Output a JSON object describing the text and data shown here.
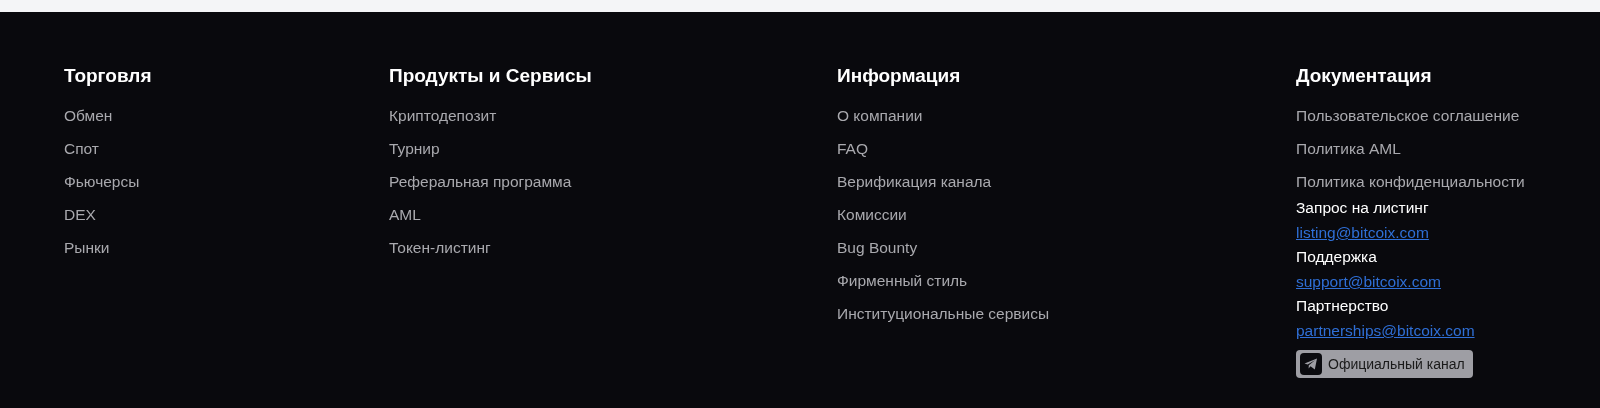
{
  "footer": {
    "columns": [
      {
        "title": "Торговля",
        "links": [
          "Обмен",
          "Спот",
          "Фьючерсы",
          "DEX",
          "Рынки"
        ]
      },
      {
        "title": "Продукты и Сервисы",
        "links": [
          "Криптодепозит",
          "Турнир",
          "Реферальная программа",
          "AML",
          "Токен-листинг"
        ]
      },
      {
        "title": "Информация",
        "links": [
          "О компании",
          "FAQ",
          "Верификация канала",
          "Комиссии",
          "Bug Bounty",
          "Фирменный стиль",
          "Институциональные сервисы"
        ]
      },
      {
        "title": "Документация",
        "links": [
          "Пользовательское соглашение",
          "Политика AML",
          "Политика конфиденциальности"
        ],
        "contacts": [
          {
            "label": "Запрос на листинг",
            "email": "listing@bitcoix.com"
          },
          {
            "label": "Поддержка",
            "email": "support@bitcoix.com"
          },
          {
            "label": "Партнерство",
            "email": "partnerships@bitcoix.com"
          }
        ],
        "channel_button": "Официальный канал"
      }
    ]
  }
}
